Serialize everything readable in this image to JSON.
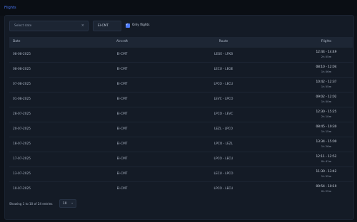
{
  "app": {
    "title": "Flights"
  },
  "filters": {
    "date_placeholder": "Select date",
    "clear_icon": "×",
    "registration": "EI-CMT",
    "only_flights_label": "Only flights",
    "only_flights_checked": true
  },
  "table": {
    "headers": [
      "Date",
      "Aircraft",
      "Route",
      "Flights"
    ],
    "rows": [
      {
        "date": "08-08-2025",
        "aircraft": "EI-CMT",
        "route": "LEGE - LFKB",
        "times": "12:44 - 14:49",
        "duration": "2h 05m"
      },
      {
        "date": "08-08-2025",
        "aircraft": "EI-CMT",
        "route": "LECU - LEGE",
        "times": "08:10 - 12:04",
        "duration": "1h 06m"
      },
      {
        "date": "07-08-2025",
        "aircraft": "EI-CMT",
        "route": "LPCO - LECU",
        "times": "10:42 - 12:37",
        "duration": "1h 55m"
      },
      {
        "date": "01-08-2025",
        "aircraft": "EI-CMT",
        "route": "LEVC - LPCO",
        "times": "09:02 - 12:02",
        "duration": "1h 00m"
      },
      {
        "date": "28-07-2025",
        "aircraft": "EI-CMT",
        "route": "LPCO - LEVC",
        "times": "12:30 - 15:25",
        "duration": "2h 10m"
      },
      {
        "date": "20-07-2025",
        "aircraft": "EI-CMT",
        "route": "LEZL - LPCO",
        "times": "08:45 - 10:30",
        "duration": "1h 15m"
      },
      {
        "date": "18-07-2025",
        "aircraft": "EI-CMT",
        "route": "LPCO - LEZL",
        "times": "13:34 - 15:00",
        "duration": "1h 26m"
      },
      {
        "date": "17-07-2025",
        "aircraft": "EI-CMT",
        "route": "LPCO - LECU",
        "times": "12:11 - 12:52",
        "duration": "0h 41m"
      },
      {
        "date": "13-07-2025",
        "aircraft": "EI-CMT",
        "route": "LECU - LPCO",
        "times": "11:30 - 13:42",
        "duration": "1h 55m"
      },
      {
        "date": "10-07-2025",
        "aircraft": "EI-CMT",
        "route": "LPCO - LECU",
        "times": "09:54 - 10:19",
        "duration": "0h 25m"
      }
    ]
  },
  "footer": {
    "info": "Showing 1 to 10 of 24 entries",
    "page_size": "10",
    "chevron_icon": "⌄"
  }
}
